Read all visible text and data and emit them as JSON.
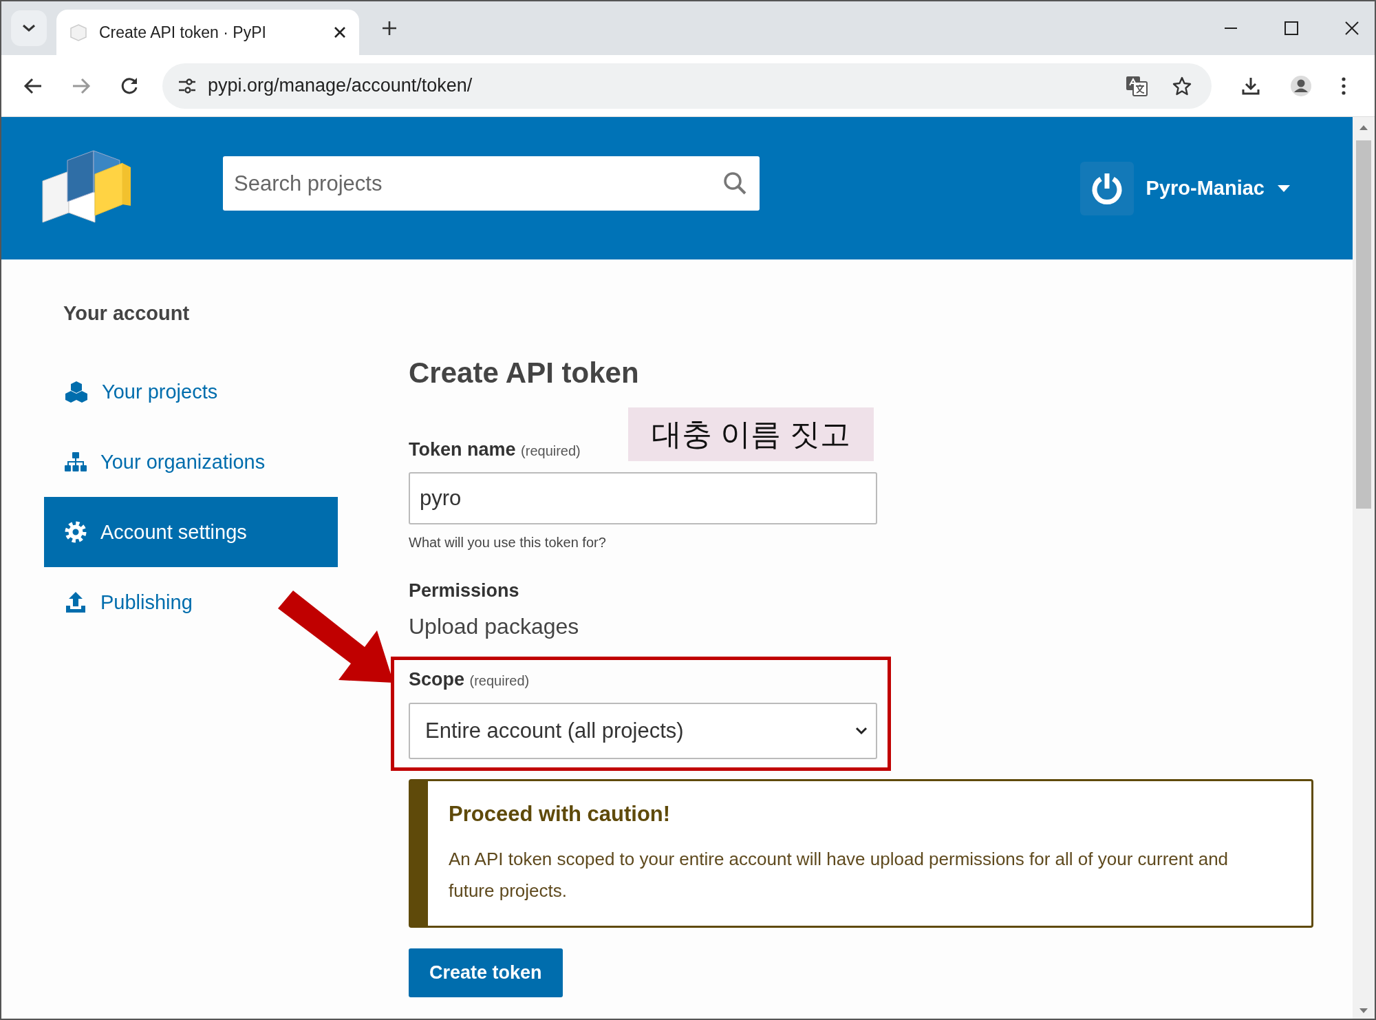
{
  "browser": {
    "tab_title": "Create API token · PyPI",
    "url": "pypi.org/manage/account/token/"
  },
  "header": {
    "search": {
      "placeholder": "Search projects"
    },
    "username": "Pyro-Maniac"
  },
  "sidebar": {
    "heading": "Your account",
    "items": [
      {
        "label": "Your projects",
        "selected": false
      },
      {
        "label": "Your organizations",
        "selected": false
      },
      {
        "label": "Account settings",
        "selected": true
      },
      {
        "label": "Publishing",
        "selected": false
      }
    ]
  },
  "form": {
    "title": "Create API token",
    "token_name": {
      "label": "Token name",
      "required": "(required)",
      "value": "pyro",
      "help": "What will you use this token for?"
    },
    "permissions": {
      "label": "Permissions",
      "value": "Upload packages"
    },
    "scope": {
      "label": "Scope",
      "required": "(required)",
      "value": "Entire account (all projects)"
    },
    "caution": {
      "title": "Proceed with caution!",
      "text": "An API token scoped to your entire account will have upload permissions for all of your current and future projects."
    },
    "submit": "Create token"
  },
  "annotation": {
    "text": "대충 이름 짓고"
  }
}
